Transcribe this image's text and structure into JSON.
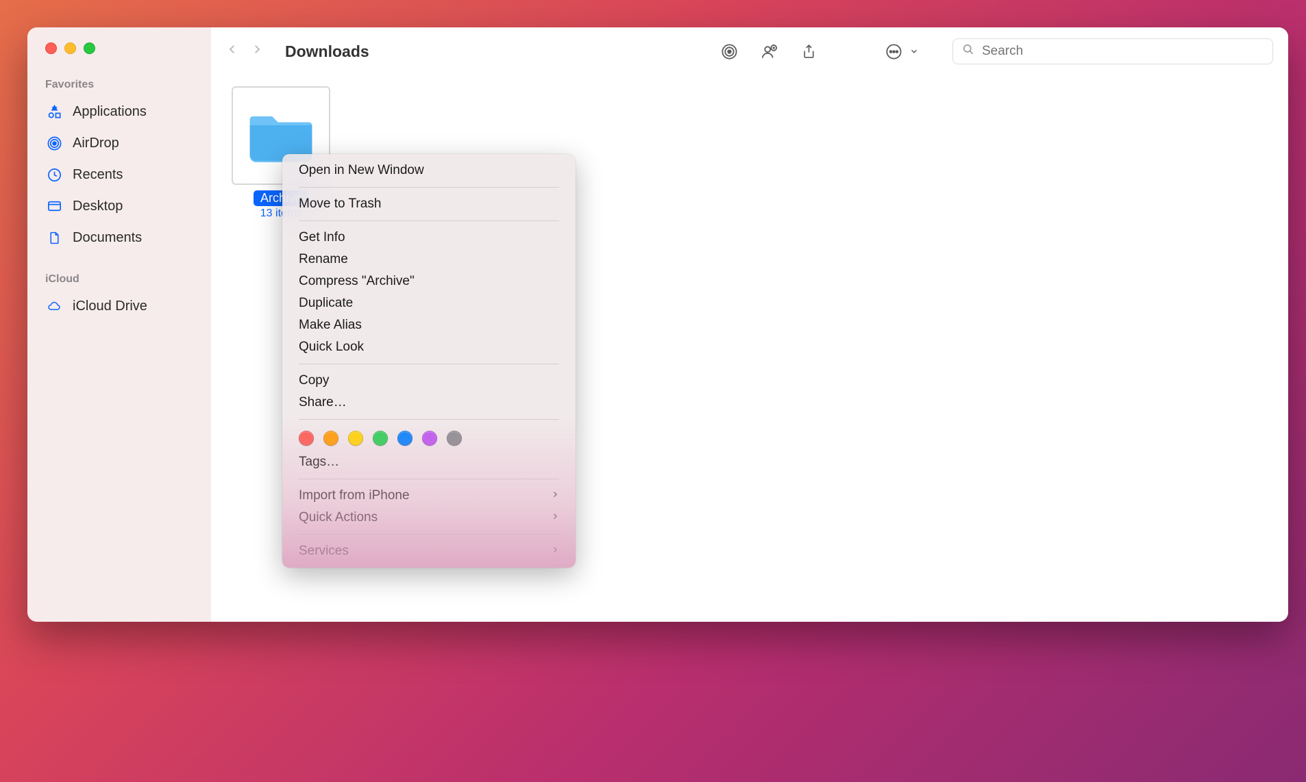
{
  "window": {
    "title": "Downloads"
  },
  "sidebar": {
    "sections": [
      {
        "label": "Favorites",
        "items": [
          {
            "icon": "applications",
            "label": "Applications"
          },
          {
            "icon": "airdrop",
            "label": "AirDrop"
          },
          {
            "icon": "recents",
            "label": "Recents"
          },
          {
            "icon": "desktop",
            "label": "Desktop"
          },
          {
            "icon": "documents",
            "label": "Documents"
          }
        ]
      },
      {
        "label": "iCloud",
        "items": [
          {
            "icon": "icloud",
            "label": "iCloud Drive"
          }
        ]
      }
    ]
  },
  "search": {
    "placeholder": "Search"
  },
  "folder": {
    "name": "Archive",
    "count": "13 items"
  },
  "context_menu": {
    "open_new_window": "Open in New Window",
    "move_to_trash": "Move to Trash",
    "get_info": "Get Info",
    "rename": "Rename",
    "compress": "Compress \"Archive\"",
    "duplicate": "Duplicate",
    "make_alias": "Make Alias",
    "quick_look": "Quick Look",
    "copy": "Copy",
    "share": "Share…",
    "tags": "Tags…",
    "import_iphone": "Import from iPhone",
    "quick_actions": "Quick Actions",
    "services": "Services",
    "tag_colors": [
      "#ff5f57",
      "#ff9f0a",
      "#ffd60a",
      "#30d158",
      "#0a84ff",
      "#bf5af2",
      "#8e8e93"
    ]
  }
}
